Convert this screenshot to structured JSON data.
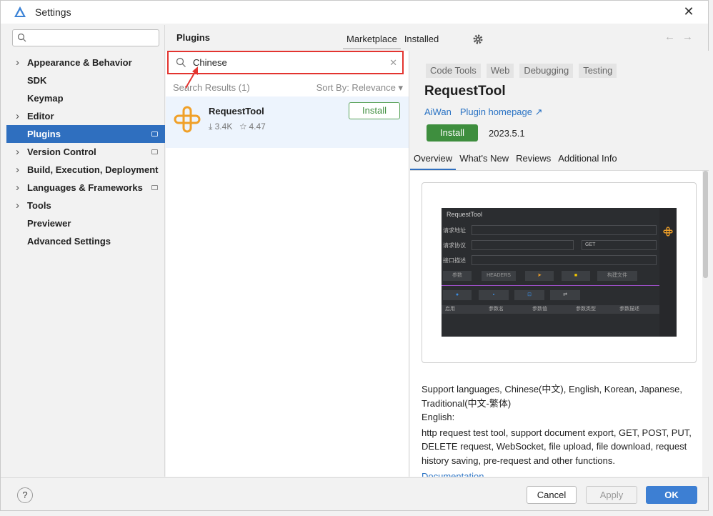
{
  "window": {
    "title": "Settings",
    "close_glyph": "✕"
  },
  "sidebar": {
    "search_placeholder": "",
    "items": [
      {
        "label": "Appearance & Behavior",
        "expandable": true,
        "marker": false
      },
      {
        "label": "SDK",
        "expandable": false,
        "marker": false
      },
      {
        "label": "Keymap",
        "expandable": false,
        "marker": false
      },
      {
        "label": "Editor",
        "expandable": true,
        "marker": false
      },
      {
        "label": "Plugins",
        "expandable": false,
        "marker": true,
        "selected": true
      },
      {
        "label": "Version Control",
        "expandable": true,
        "marker": true
      },
      {
        "label": "Build, Execution, Deployment",
        "expandable": true,
        "marker": false
      },
      {
        "label": "Languages & Frameworks",
        "expandable": true,
        "marker": true
      },
      {
        "label": "Tools",
        "expandable": true,
        "marker": false
      },
      {
        "label": "Previewer",
        "expandable": false,
        "marker": false
      },
      {
        "label": "Advanced Settings",
        "expandable": false,
        "marker": false
      }
    ]
  },
  "plugins": {
    "title": "Plugins",
    "tabs": [
      "Marketplace",
      "Installed"
    ],
    "search_value": "Chinese",
    "results_label": "Search Results (1)",
    "sort_label": "Sort By: Relevance ▾",
    "result": {
      "name": "RequestTool",
      "downloads": "⤓ 3.4K",
      "rating": "☆ 4.47",
      "install_label": "Install"
    }
  },
  "detail": {
    "tags": [
      "Code Tools",
      "Web",
      "Debugging",
      "Testing"
    ],
    "title": "RequestTool",
    "vendor": "AiWan",
    "homepage": "Plugin homepage ↗",
    "install_label": "Install",
    "version": "2023.5.1",
    "tabs": [
      "Overview",
      "What's New",
      "Reviews",
      "Additional Info"
    ],
    "screenshot": {
      "title": "RequestTool",
      "label1": "请求地址",
      "label2": "请求协议",
      "label3": "接口描述",
      "method": "GET",
      "chips": [
        "参数",
        "HEADERS",
        "",
        "",
        "构建文件"
      ],
      "table_headers": [
        "启用",
        "参数名",
        "参数值",
        "参数类型",
        "参数描述"
      ]
    },
    "description": {
      "line1": "Support languages, Chinese(中文), English, Korean, Japanese, Traditional(中文-繁体)",
      "line2": "English:",
      "line3": "http request test tool, support document export, GET, POST, PUT, DELETE request, WebSocket, file upload, file download, request history saving, pre-request and other functions.",
      "doc_link": "Documentation"
    }
  },
  "footer": {
    "help": "?",
    "cancel": "Cancel",
    "apply": "Apply",
    "ok": "OK"
  },
  "colors": {
    "accent": "#2f6fbf",
    "install": "#3e8e3e",
    "highlight": "#e3342f"
  }
}
